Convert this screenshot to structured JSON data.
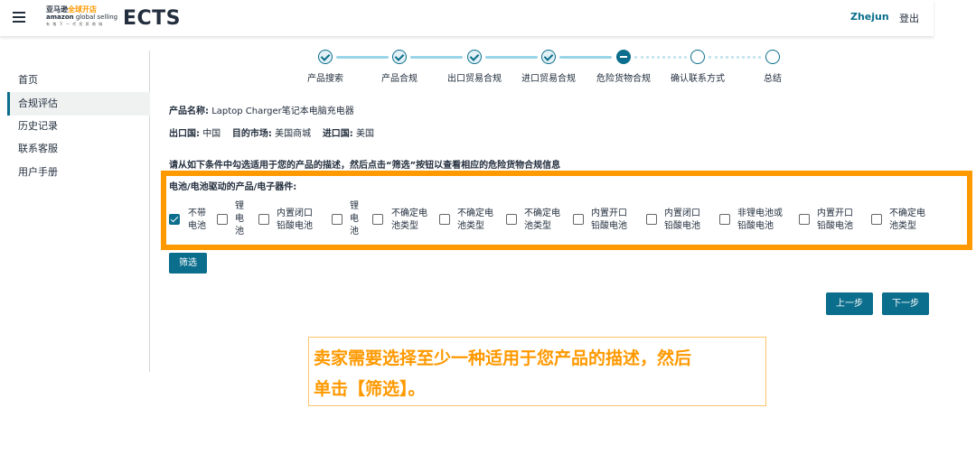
{
  "header": {
    "logo": {
      "line1_cn": "亚马逊",
      "line1_accent": "全球开店",
      "line2_brand": "amazon",
      "line2_text": "global selling",
      "line3": "有 笔 下 一 代 优 质 商 城"
    },
    "app_title": "ECTS",
    "user_name": "Zhejun",
    "logout_label": "登出"
  },
  "sidebar": {
    "items": [
      {
        "label": "首页",
        "active": false
      },
      {
        "label": "合规评估",
        "active": true
      },
      {
        "label": "历史记录",
        "active": false
      },
      {
        "label": "联系客服",
        "active": false
      },
      {
        "label": "用户手册",
        "active": false
      }
    ]
  },
  "stepper": {
    "steps": [
      {
        "label": "产品搜索",
        "state": "done"
      },
      {
        "label": "产品合规",
        "state": "done"
      },
      {
        "label": "出口贸易合规",
        "state": "done"
      },
      {
        "label": "进口贸易合规",
        "state": "done"
      },
      {
        "label": "危险货物合规",
        "state": "current"
      },
      {
        "label": "确认联系方式",
        "state": "todo"
      },
      {
        "label": "总结",
        "state": "todo"
      }
    ]
  },
  "product": {
    "name_label": "产品名称:",
    "name_value": "Laptop Charger笔记本电脑充电器",
    "export_label": "出口国:",
    "export_value": "中国",
    "market_label": "目的市场:",
    "market_value": "美国商城",
    "import_label": "进口国:",
    "import_value": "美国"
  },
  "instruction": "请从如下条件中勾选适用于您的产品的描述，然后点击“筛选”按钮以查看相应的危险货物合规信息",
  "battery_group": {
    "title": "电池/电池驱动的产品/电子器件:",
    "options": [
      {
        "label_lines": [
          "不带",
          "电池"
        ],
        "checked": true
      },
      {
        "label_lines": [
          "锂",
          "电",
          "池"
        ],
        "checked": false
      },
      {
        "label_lines": [
          "内置闭口",
          "铅酸电池"
        ],
        "checked": false
      },
      {
        "label_lines": [
          "锂",
          "电",
          "池"
        ],
        "checked": false
      },
      {
        "label_lines": [
          "不确定电",
          "池类型"
        ],
        "checked": false
      },
      {
        "label_lines": [
          "不确定电",
          "池类型"
        ],
        "checked": false
      },
      {
        "label_lines": [
          "不确定电",
          "池类型"
        ],
        "checked": false
      },
      {
        "label_lines": [
          "内置开口",
          "铅酸电池"
        ],
        "checked": false
      },
      {
        "label_lines": [
          "内置闭口",
          "铅酸电池"
        ],
        "checked": false
      },
      {
        "label_lines": [
          "非锂电池或",
          "铅酸电池"
        ],
        "checked": false
      },
      {
        "label_lines": [
          "内置开口",
          "铅酸电池"
        ],
        "checked": false
      },
      {
        "label_lines": [
          "不确定电",
          "池类型"
        ],
        "checked": false
      }
    ]
  },
  "buttons": {
    "filter": "筛选",
    "prev": "上一步",
    "next": "下一步"
  },
  "callout": {
    "line1": "卖家需要选择至少一种适用于您产品的描述，然后",
    "line2": "单击【筛选】。"
  },
  "colors": {
    "accent": "#0a6e8c",
    "highlight": "#ff9900",
    "text": "#232f3e"
  }
}
